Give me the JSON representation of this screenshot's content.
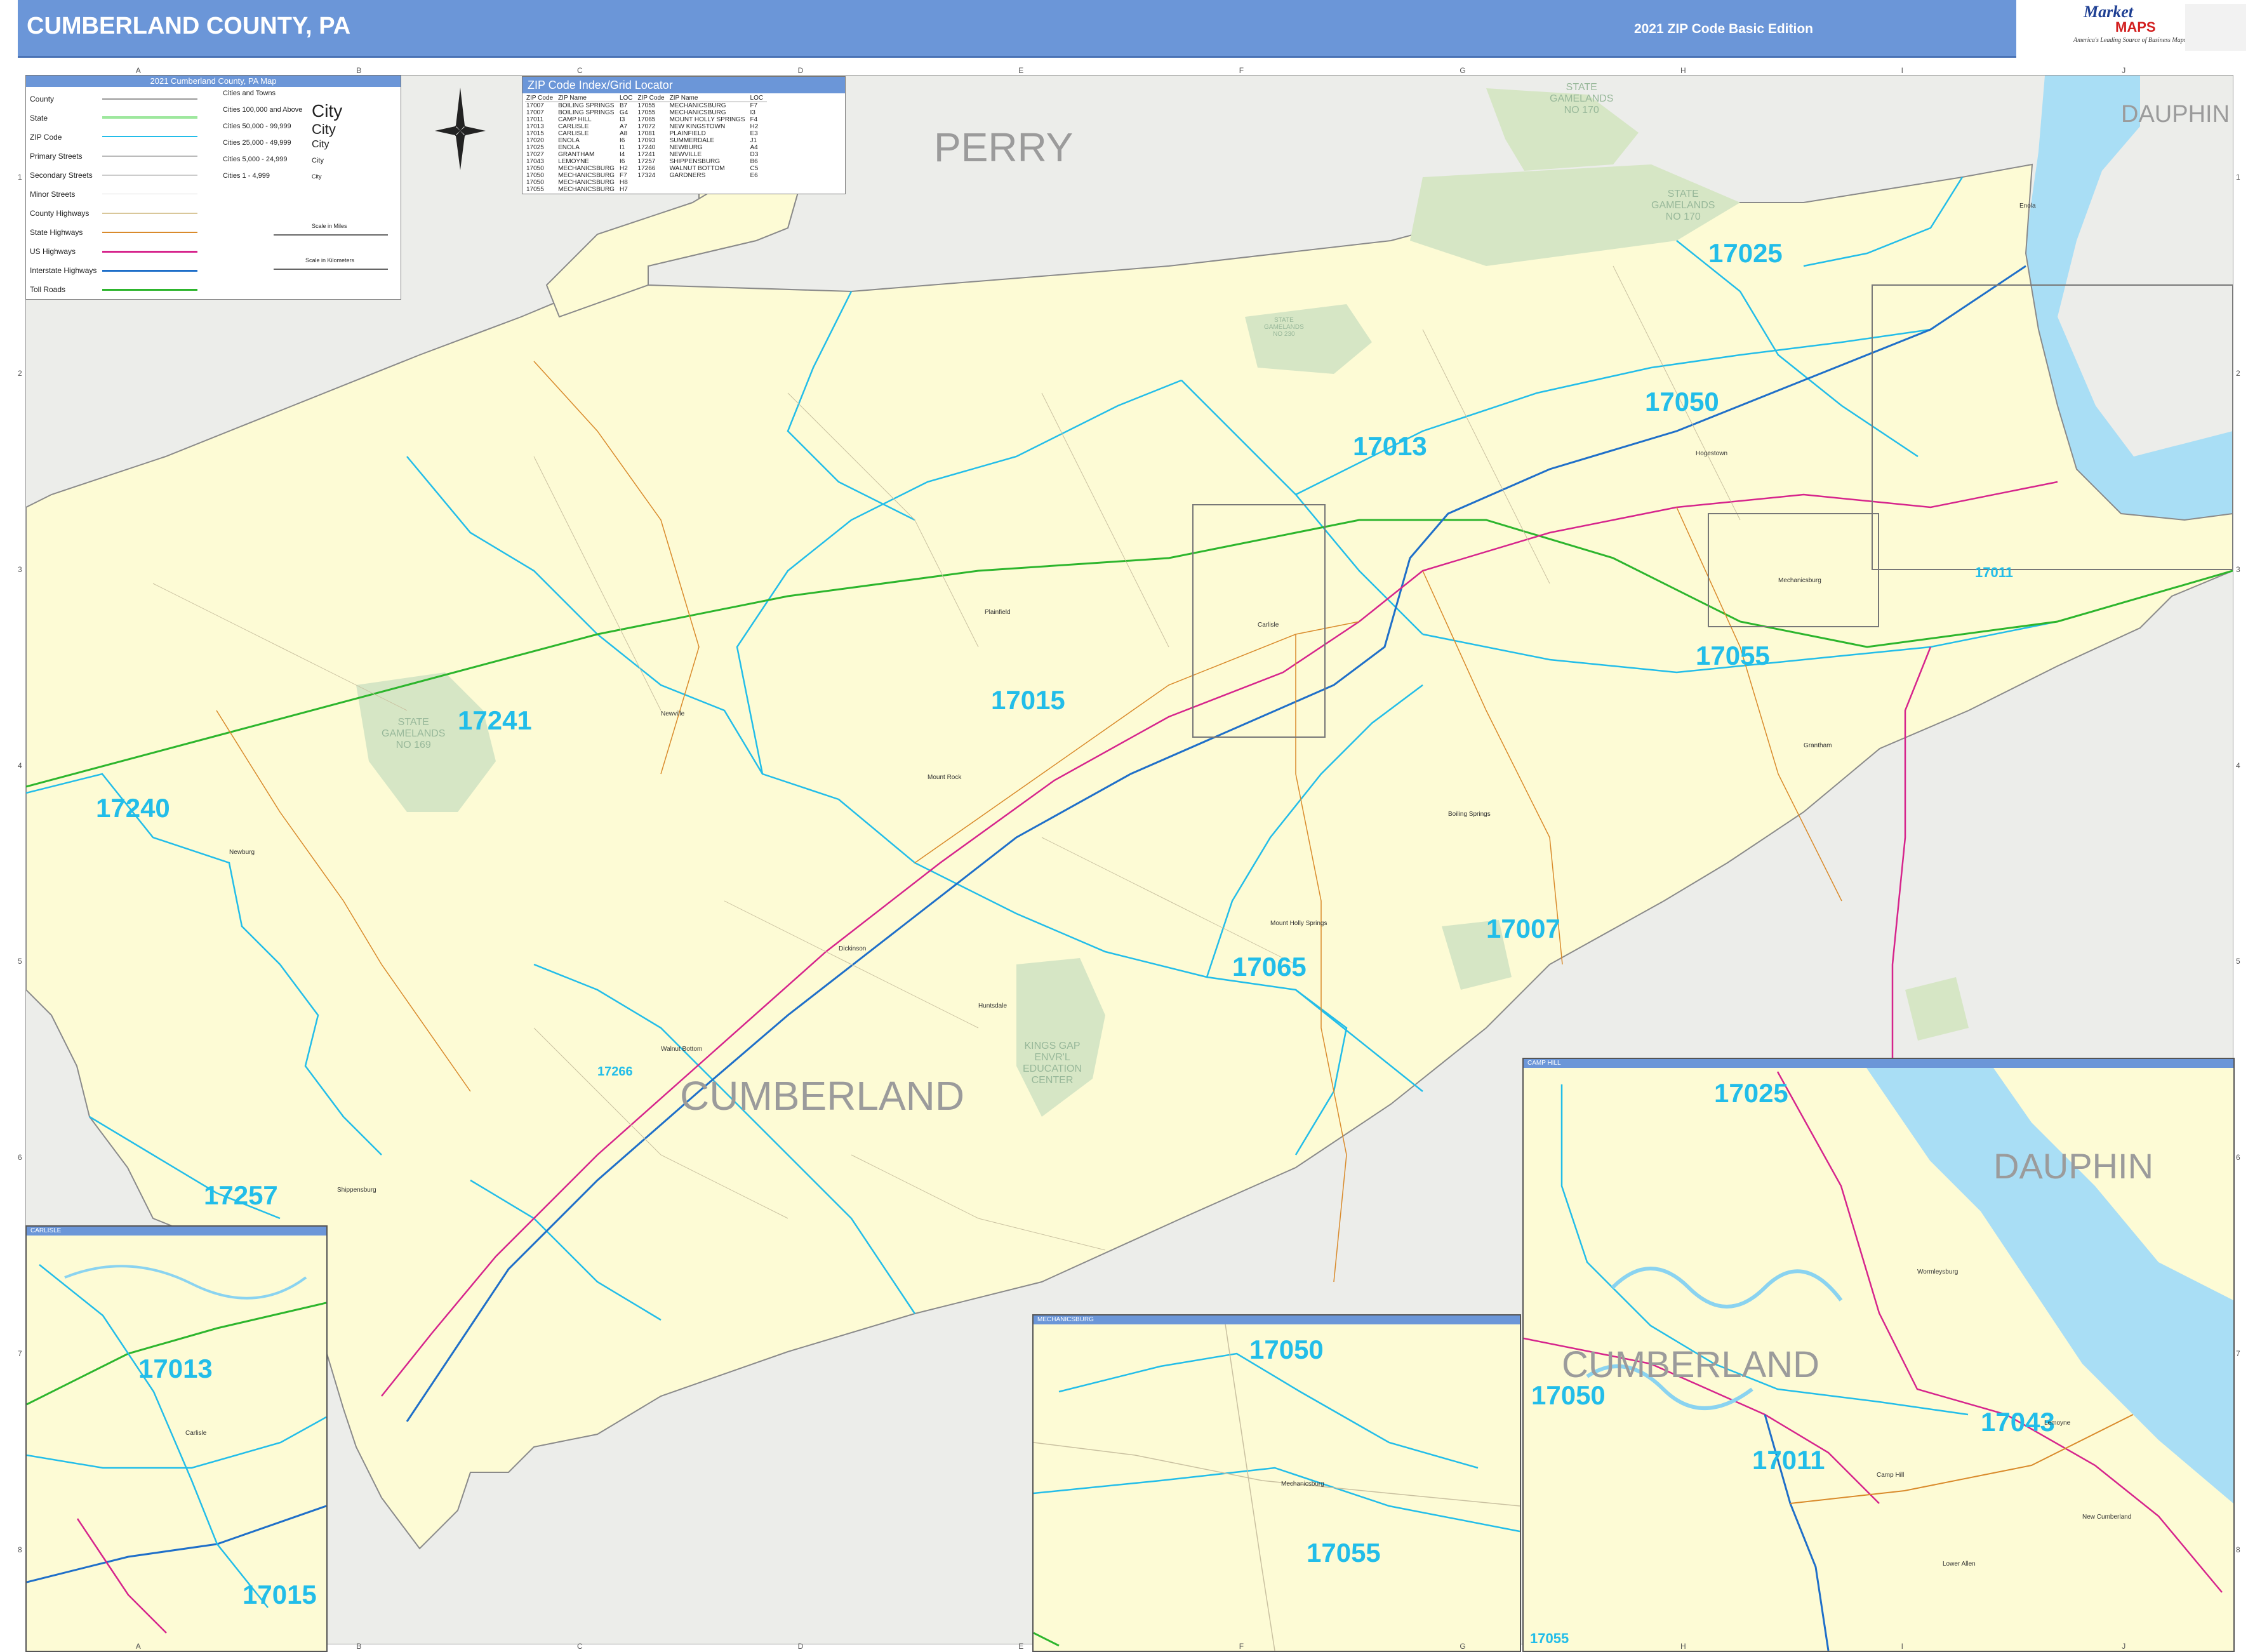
{
  "header": {
    "title": "CUMBERLAND COUNTY, PA",
    "edition": "2021 ZIP Code Basic Edition"
  },
  "logo": {
    "name": "Market",
    "maps": "MAPS",
    "tagline": "America's Leading Source of Business Maps"
  },
  "legend": {
    "title": "2021 Cumberland County, PA Map",
    "items": [
      "County",
      "State",
      "ZIP Code",
      "Primary Streets",
      "Secondary Streets",
      "Minor Streets",
      "County Highways",
      "State Highways",
      "US Highways",
      "Interstate Highways",
      "Toll Roads"
    ],
    "cities_title": "Cities and Towns",
    "cities": [
      "Cities 100,000 and Above",
      "Cities 50,000 - 99,999",
      "Cities 25,000 - 49,999",
      "Cities 5,000 - 24,999",
      "Cities 1 - 4,999"
    ],
    "city_samples": [
      "City",
      "City",
      "City",
      "City",
      "City"
    ],
    "scale_miles": "Scale in Miles",
    "scale_km": "Scale in Kilometers"
  },
  "zip_index": {
    "title": "ZIP Code Index/Grid Locator",
    "headers": [
      "ZIP Code",
      "ZIP Name",
      "LOC",
      "ZIP Code",
      "ZIP Name",
      "LOC"
    ],
    "rows": [
      [
        "17007",
        "BOILING SPRINGS",
        "B7",
        "17055",
        "MECHANICSBURG",
        "F7"
      ],
      [
        "17007",
        "BOILING SPRINGS",
        "G4",
        "17055",
        "MECHANICSBURG",
        "I3"
      ],
      [
        "17011",
        "CAMP HILL",
        "I3",
        "17065",
        "MOUNT HOLLY SPRINGS",
        "F4"
      ],
      [
        "17013",
        "CARLISLE",
        "A7",
        "17072",
        "NEW KINGSTOWN",
        "H2"
      ],
      [
        "17015",
        "CARLISLE",
        "A8",
        "17081",
        "PLAINFIELD",
        "E3"
      ],
      [
        "17020",
        "ENOLA",
        "I6",
        "17093",
        "SUMMERDALE",
        "J1"
      ],
      [
        "17025",
        "ENOLA",
        "I1",
        "17240",
        "NEWBURG",
        "A4"
      ],
      [
        "17027",
        "GRANTHAM",
        "I4",
        "17241",
        "NEWVILLE",
        "D3"
      ],
      [
        "17043",
        "LEMOYNE",
        "I6",
        "17257",
        "SHIPPENSBURG",
        "B6"
      ],
      [
        "17050",
        "MECHANICSBURG",
        "H2",
        "17266",
        "WALNUT BOTTOM",
        "C5"
      ],
      [
        "17050",
        "MECHANICSBURG",
        "F7",
        "17324",
        "GARDNERS",
        "E6"
      ],
      [
        "17050",
        "MECHANICSBURG",
        "H8",
        "",
        "",
        ""
      ],
      [
        "17055",
        "MECHANICSBURG",
        "H7",
        "",
        "",
        ""
      ]
    ]
  },
  "counties": {
    "perry": "PERRY",
    "cumberland": "CUMBERLAND",
    "dauphin": "DAUPHIN",
    "dauphin_inset": "DAUPHIN",
    "cumberland_inset": "CUMBERLAND"
  },
  "gamelands": {
    "g170a": "STATE\nGAMELANDS\nNO 170",
    "g170b": "STATE\nGAMELANDS\nNO 170",
    "g169": "STATE\nGAMELANDS\nNO 169",
    "g230": "STATE\nGAMELANDS\nNO 230",
    "kings_gap": "KINGS GAP\nENVR'L\nEDUCATION\nCENTER"
  },
  "zips": {
    "z17025": "17025",
    "z17050": "17050",
    "z17013": "17013",
    "z17011": "17011",
    "z17055": "17055",
    "z17015": "17015",
    "z17241": "17241",
    "z17240": "17240",
    "z17007": "17007",
    "z17065": "17065",
    "z17257": "17257",
    "z17266": "17266",
    "carlisle_17013": "17013",
    "carlisle_17015": "17015",
    "mech_17050": "17050",
    "mech_17055": "17055",
    "camp_17025": "17025",
    "camp_17050": "17050",
    "camp_17043": "17043",
    "camp_17011": "17011",
    "camp_17055": "17055"
  },
  "towns": {
    "newville": "Newville",
    "shippensburg": "Shippensburg",
    "carlisle": "Carlisle",
    "mechanicsburg": "Mechanicsburg",
    "boiling_springs": "Boiling Springs",
    "mt_holly": "Mount Holly Springs",
    "plainfield": "Plainfield",
    "camp_hill": "Camp Hill",
    "new_cumberland": "New Cumberland",
    "lemoyne": "Lemoyne",
    "enola": "Enola",
    "newburg": "Newburg",
    "walnut_bottom": "Walnut Bottom",
    "mount_rock": "Mount Rock",
    "dickinson": "Dickinson",
    "huntsdale": "Huntsdale",
    "grantham": "Grantham",
    "lower_allen": "Lower Allen",
    "wormleysburg": "Wormleysburg",
    "hampden": "Hogestown"
  },
  "insets": {
    "carlisle": "CARLISLE",
    "mechanicsburg": "MECHANICSBURG",
    "camp_hill": "CAMP HILL",
    "box_carlisle": "CARLISLE",
    "box_mech": "MECHANICSBURG",
    "box_camp": "CAMP HILL"
  },
  "grid": {
    "columns": [
      "A",
      "B",
      "C",
      "D",
      "E",
      "F",
      "G",
      "H",
      "I",
      "J"
    ],
    "rows": [
      "1",
      "2",
      "3",
      "4",
      "5",
      "6",
      "7",
      "8"
    ]
  },
  "colors": {
    "header": "#6b96d8",
    "county_fill": "#fdfbd5",
    "zip_boundary": "#22bde9",
    "interstate": "#1f6fc9",
    "us_highway": "#d6248c",
    "toll_road": "#2db52d",
    "state_highway": "#d98a2b",
    "water": "#a9def5",
    "gameland": "#d6e6c5"
  }
}
